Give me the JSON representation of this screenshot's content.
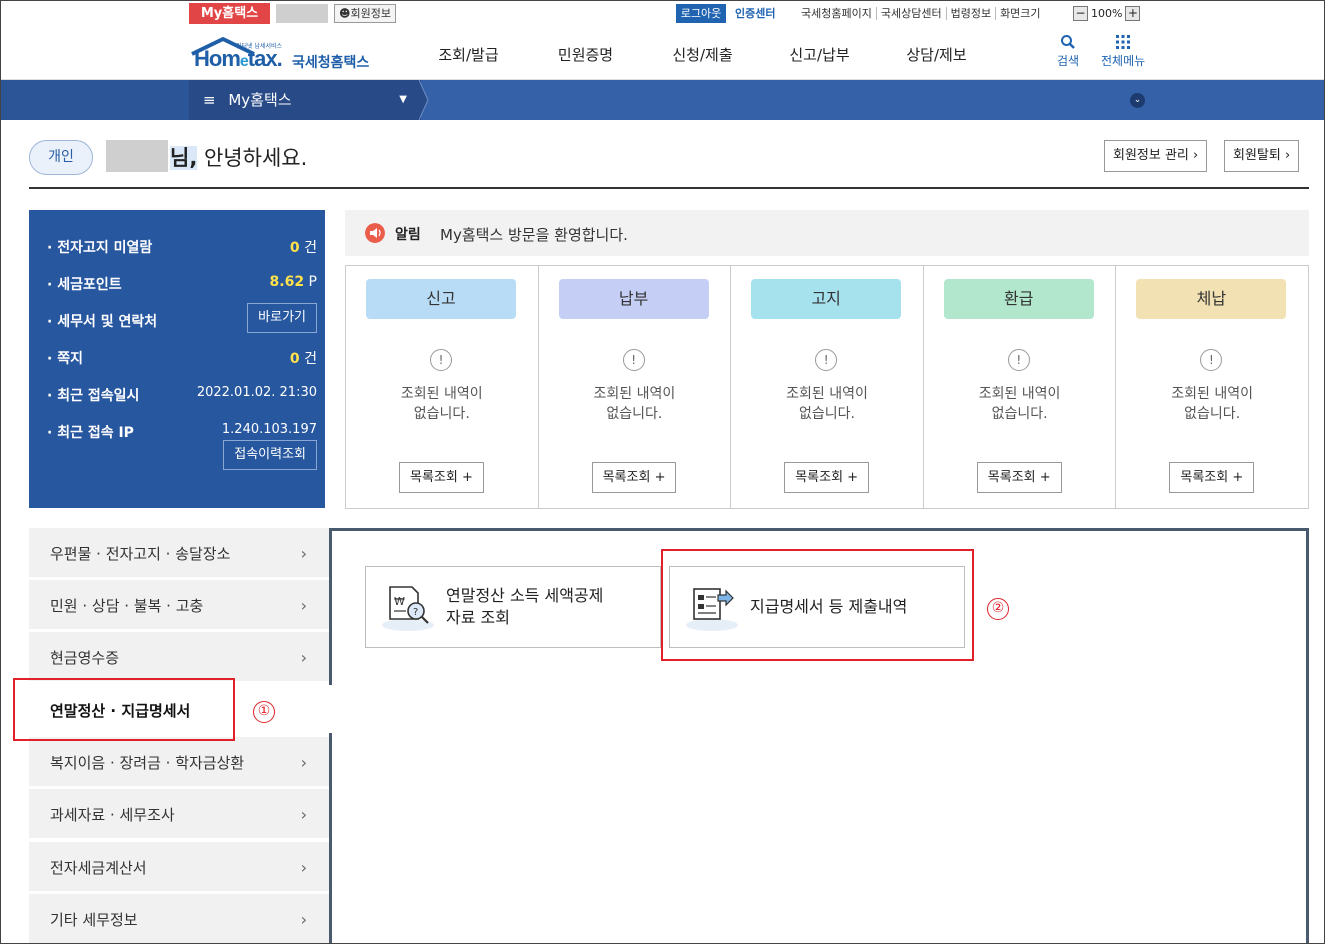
{
  "util_bar": {
    "my_hometax": "My홈택스",
    "member_info": "회원정보",
    "logout": "로그아웃",
    "cert_center": "인증센터",
    "links": [
      "국세청홈페이지",
      "국세상담센터",
      "법령정보",
      "화면크기"
    ],
    "zoom_minus": "−",
    "zoom_level": "100%",
    "zoom_plus": "+"
  },
  "header": {
    "logo_tiny": "인터넷 납세서비스",
    "logo_brand_left": "Hom",
    "logo_brand_e": "e",
    "logo_brand_right": "tax.",
    "logo_korean": "국세청홈택스",
    "gnb": [
      "조회/발급",
      "민원증명",
      "신청/제출",
      "신고/납부",
      "상담/제보"
    ],
    "search_label": "검색",
    "all_menu_label": "전체메뉴"
  },
  "navbar": {
    "menu_glyph": "≡",
    "selected": "My홈택스",
    "arrow": "▼",
    "expand": "⌄"
  },
  "greeting": {
    "user_type": "개인",
    "nim": "님,",
    "text": " 안녕하세요.",
    "member_manage": "회원정보 관리 ›",
    "withdraw": "회원탈퇴 ›"
  },
  "info_panel": {
    "e_notice_label": "· 전자고지 미열람",
    "e_notice_count": "0",
    "e_notice_unit": " 건",
    "points_label": "· 세금포인트",
    "points_value": "8.62",
    "points_unit": " P",
    "tax_office_label": "· 세무서 및 연락처",
    "tax_office_btn": "바로가기",
    "notes_label": "· 쪽지",
    "notes_count": "0",
    "notes_unit": " 건",
    "last_login_label": "· 최근 접속일시",
    "last_login_value": "2022.01.02.  21:30",
    "last_ip_label": "· 최근 접속 IP",
    "last_ip_value": "1.240.103.197",
    "history_btn": "접속이력조회"
  },
  "notice": {
    "label": "알림",
    "message": "My홈택스 방문을 환영합니다."
  },
  "status_boxes": [
    {
      "tag": "신고",
      "color": "#b9dcf6",
      "empty_line1": "조회된 내역이",
      "empty_line2": "없습니다.",
      "more": "목록조회 +"
    },
    {
      "tag": "납부",
      "color": "#c5cff6",
      "empty_line1": "조회된 내역이",
      "empty_line2": "없습니다.",
      "more": "목록조회 +"
    },
    {
      "tag": "고지",
      "color": "#a6e2ee",
      "empty_line1": "조회된 내역이",
      "empty_line2": "없습니다.",
      "more": "목록조회 +"
    },
    {
      "tag": "환급",
      "color": "#b2e6cd",
      "empty_line1": "조회된 내역이",
      "empty_line2": "없습니다.",
      "more": "목록조회 +"
    },
    {
      "tag": "체납",
      "color": "#f2e2b3",
      "empty_line1": "조회된 내역이",
      "empty_line2": "없습니다.",
      "more": "목록조회 +"
    }
  ],
  "status_warn_glyph": "!",
  "left_menu": [
    {
      "label": "우편물 · 전자고지 · 송달장소"
    },
    {
      "label": "민원 · 상담 · 불복 · 고충"
    },
    {
      "label": "현금영수증"
    },
    {
      "label": "연말정산 · 지급명세서"
    },
    {
      "label": "복지이음 · 장려금 · 학자금상환"
    },
    {
      "label": "과세자료 · 세무조사"
    },
    {
      "label": "전자세금계산서"
    },
    {
      "label": "기타 세무정보"
    }
  ],
  "left_menu_chevron": "›",
  "cards": {
    "year_end": "연말정산 소득 세액공제\n자료 조회",
    "payment_statement": "지급명세서 등 제출내역"
  },
  "annotations": {
    "num1": "①",
    "num2": "②"
  },
  "colors": {
    "brand_blue": "#1f5fa8",
    "nav_blue": "#3461a8",
    "info_blue": "#27579f",
    "annotation_red": "#e0202a"
  }
}
